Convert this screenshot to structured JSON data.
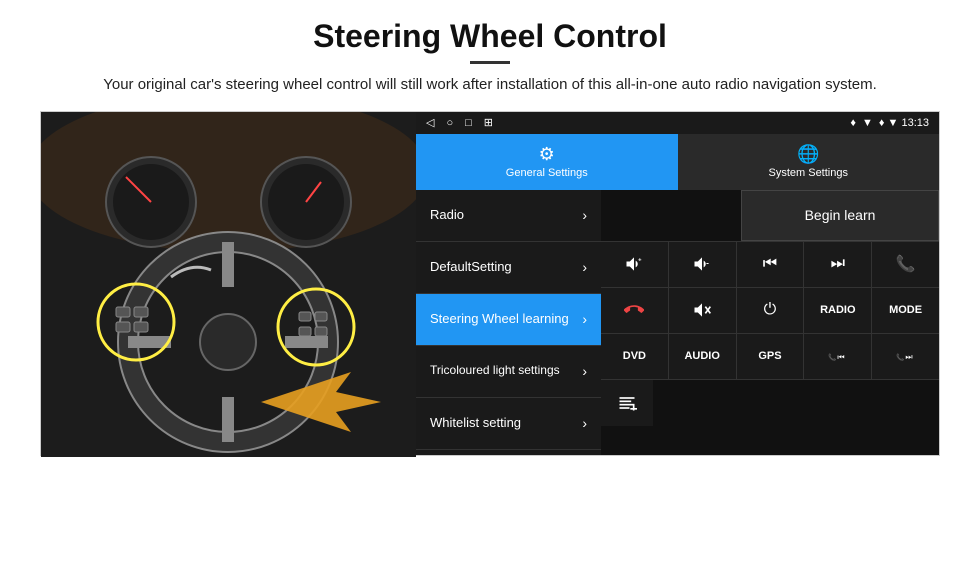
{
  "header": {
    "title": "Steering Wheel Control",
    "divider": true,
    "subtitle": "Your original car's steering wheel control will still work after installation of this all-in-one auto radio navigation system."
  },
  "status_bar": {
    "icons": [
      "◁",
      "○",
      "□",
      "⊞"
    ],
    "right": "♦ ▼  13:13"
  },
  "tabs": [
    {
      "id": "general",
      "label": "General Settings",
      "active": true
    },
    {
      "id": "system",
      "label": "System Settings",
      "active": false
    }
  ],
  "menu_items": [
    {
      "id": "radio",
      "label": "Radio",
      "active": false
    },
    {
      "id": "default",
      "label": "DefaultSetting",
      "active": false
    },
    {
      "id": "steering",
      "label": "Steering Wheel learning",
      "active": true
    },
    {
      "id": "tricoloured",
      "label": "Tricoloured light settings",
      "active": false
    },
    {
      "id": "whitelist",
      "label": "Whitelist setting",
      "active": false
    }
  ],
  "controls": {
    "begin_learn_label": "Begin learn",
    "rows": [
      [
        {
          "type": "icon",
          "icon": "vol_up",
          "label": "🔊+"
        },
        {
          "type": "icon",
          "icon": "vol_down",
          "label": "🔉-"
        },
        {
          "type": "icon",
          "icon": "prev",
          "label": "⏮"
        },
        {
          "type": "icon",
          "icon": "next",
          "label": "⏭"
        },
        {
          "type": "icon",
          "icon": "phone",
          "label": "📞"
        }
      ],
      [
        {
          "type": "icon",
          "icon": "hangup",
          "label": "↩"
        },
        {
          "type": "icon",
          "icon": "mute",
          "label": "🔇"
        },
        {
          "type": "icon",
          "icon": "power",
          "label": "⏻"
        },
        {
          "type": "text",
          "label": "RADIO"
        },
        {
          "type": "text",
          "label": "MODE"
        }
      ],
      [
        {
          "type": "text",
          "label": "DVD"
        },
        {
          "type": "text",
          "label": "AUDIO"
        },
        {
          "type": "text",
          "label": "GPS"
        },
        {
          "type": "icon",
          "icon": "tel_prev",
          "label": "📞⏮"
        },
        {
          "type": "icon",
          "icon": "tel_next",
          "label": "📞⏭"
        }
      ],
      [
        {
          "type": "icon",
          "icon": "list",
          "label": "≡"
        }
      ]
    ]
  }
}
